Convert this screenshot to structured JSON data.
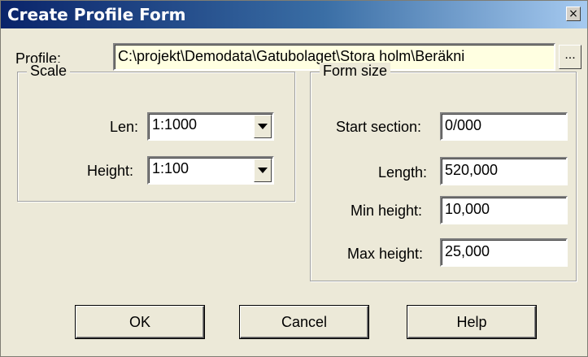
{
  "window": {
    "title": "Create Profile Form",
    "close_glyph": "×"
  },
  "profile": {
    "label": "Profile:",
    "value": "C:\\projekt\\Demodata\\Gatubolaget\\Stora holm\\Beräkni",
    "browse_label": "..."
  },
  "scale": {
    "legend": "Scale",
    "len": {
      "label": "Len:",
      "value": "1:1000"
    },
    "height": {
      "label": "Height:",
      "value": "1:100"
    }
  },
  "form_size": {
    "legend": "Form size",
    "start_section": {
      "label": "Start section:",
      "value": "0/000"
    },
    "length": {
      "label": "Length:",
      "value": "520,000"
    },
    "min_height": {
      "label": "Min height:",
      "value": "10,000"
    },
    "max_height": {
      "label": "Max height:",
      "value": "25,000"
    }
  },
  "buttons": {
    "ok": "OK",
    "cancel": "Cancel",
    "help": "Help"
  }
}
